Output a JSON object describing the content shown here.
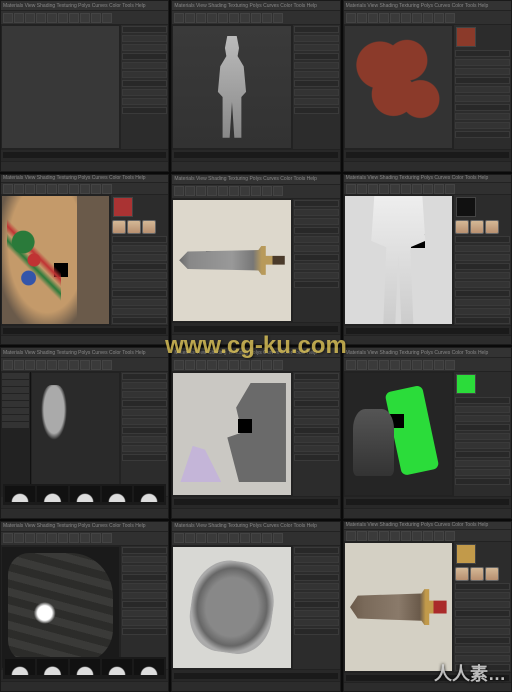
{
  "app": {
    "menu": "Materials View Shading Texturing Polys Curves Color Tools Help"
  },
  "watermark": "www.cg-ku.com",
  "logo": "人人素…",
  "panels": [
    {
      "id": "p01",
      "viewport": "empty",
      "side": "narrow",
      "swatch": null
    },
    {
      "id": "p02",
      "viewport": "figure",
      "side": "narrow",
      "swatch": null
    },
    {
      "id": "p03",
      "viewport": "uvred",
      "side": "wide",
      "swatch": "#8b3a2a"
    },
    {
      "id": "p04",
      "viewport": "dragon",
      "side": "wide",
      "swatch": "#aa3333",
      "faces": true,
      "blacksq": "s5"
    },
    {
      "id": "p05",
      "viewport": "sword",
      "side": "narrow",
      "swatch": null,
      "blacksq": "s1"
    },
    {
      "id": "p06",
      "viewport": "legs",
      "side": "wide",
      "swatch": "#111",
      "faces": true,
      "blacksq": "s4"
    },
    {
      "id": "p07",
      "viewport": "head",
      "side": "narrow",
      "swatch": null,
      "curves": true,
      "minilist": true
    },
    {
      "id": "p08",
      "viewport": "faceuv",
      "side": "narrow",
      "swatch": null,
      "blacksq": "s2"
    },
    {
      "id": "p09",
      "viewport": "green",
      "side": "wide",
      "swatch": "#2bdc3a",
      "blacksq": "s3"
    },
    {
      "id": "p10",
      "viewport": "glove",
      "side": "narrow",
      "swatch": null,
      "curves": true
    },
    {
      "id": "p11",
      "viewport": "sandal",
      "side": "narrow",
      "swatch": null
    },
    {
      "id": "p12",
      "viewport": "sword2",
      "side": "wide",
      "swatch": "#c29a4a",
      "faces": true
    }
  ],
  "viewport_classes": {
    "empty": "vp-empty",
    "figure": "vp-figure",
    "uvred": "vp-uvred",
    "dragon": "vp-dragon",
    "sword": "vp-sword",
    "legs": "vp-legs",
    "head": "vp-head",
    "faceuv": "vp-faceuv",
    "green": "vp-green",
    "glove": "vp-glove",
    "sandal": "vp-sandal",
    "sword2": "vp-sword2"
  }
}
